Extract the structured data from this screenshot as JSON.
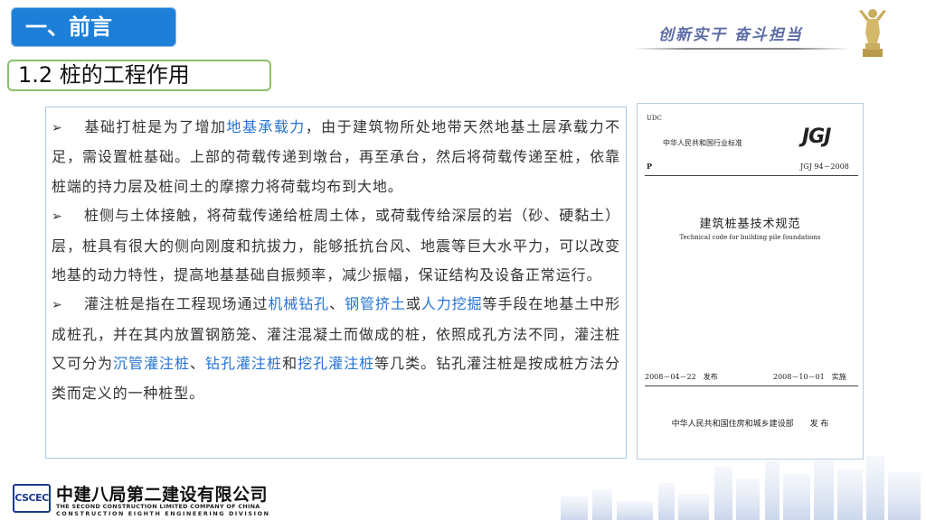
{
  "header": {
    "title": "一、前言",
    "slogan": "创新实干 奋斗担当"
  },
  "section": {
    "title": "1.2 桩的工程作用"
  },
  "content": {
    "bullet": "➢",
    "p1": {
      "t1": "基础打桩是为了增加",
      "h1": "地基承载力",
      "t2": "，由于建筑物所处地带天然地基土层承载力不足，需设置桩基础。上部的荷载传递到墩台，再至承台，然后将荷载传递至桩，依靠桩端的持力层及桩间土的摩擦力将荷载均布到大地。"
    },
    "p2": {
      "t1": "桩侧与土体接触，将荷载传递给桩周土体，或荷载传给深层的岩（砂、硬黏土）层，桩具有很大的侧向刚度和抗拔力，能够抵抗台风、地震等巨大水平力，可以改变地基的动力特性，提高地基基础自振频率，减少振幅，保证结构及设备正常运行。"
    },
    "p3": {
      "t1": "灌注桩是指在工程现场通过",
      "h1": "机械钻孔",
      "t2": "、",
      "h2": "钢管挤土",
      "t3": "或",
      "h3": "人力挖掘",
      "t4": "等手段在地基土中形成桩孔，并在其内放置钢筋笼、灌注混凝土而做成的桩，依照成孔方法不同，灌注桩又可分为",
      "h4": "沉管灌注桩",
      "t5": "、",
      "h5": "钻孔灌注桩",
      "t6": "和",
      "h6": "挖孔灌注桩",
      "t7": "等几类。钻孔灌注桩是按成桩方法分类而定义的一种桩型。"
    },
    "highlight_color": "#2574d4"
  },
  "document_cover": {
    "udc": "UDC",
    "standard_type": "中华人民共和国行业标准",
    "logo": "JGJ",
    "p_label": "P",
    "code": "JGJ 94－2008",
    "title_cn": "建筑桩基技术规范",
    "title_en": "Technical code for building pile foundations",
    "issue_date": "2008－04－22　发布",
    "impl_date": "2008－10－01　实施",
    "publisher": "中华人民共和国住房和城乡建设部　　发 布"
  },
  "company": {
    "logo_text": "CSCEC",
    "name_cn": "中建八局第二建设有限公司",
    "name_en1": "THE SECOND CONSTRUCTION LIMITED COMPANY OF CHINA",
    "name_en2": "CONSTRUCTION EIGHTH ENGINEERING DIVISION"
  },
  "colors": {
    "header_blue": "#1e7fd8",
    "section_border": "#8bc06a",
    "slogan": "#5b6ca6"
  }
}
